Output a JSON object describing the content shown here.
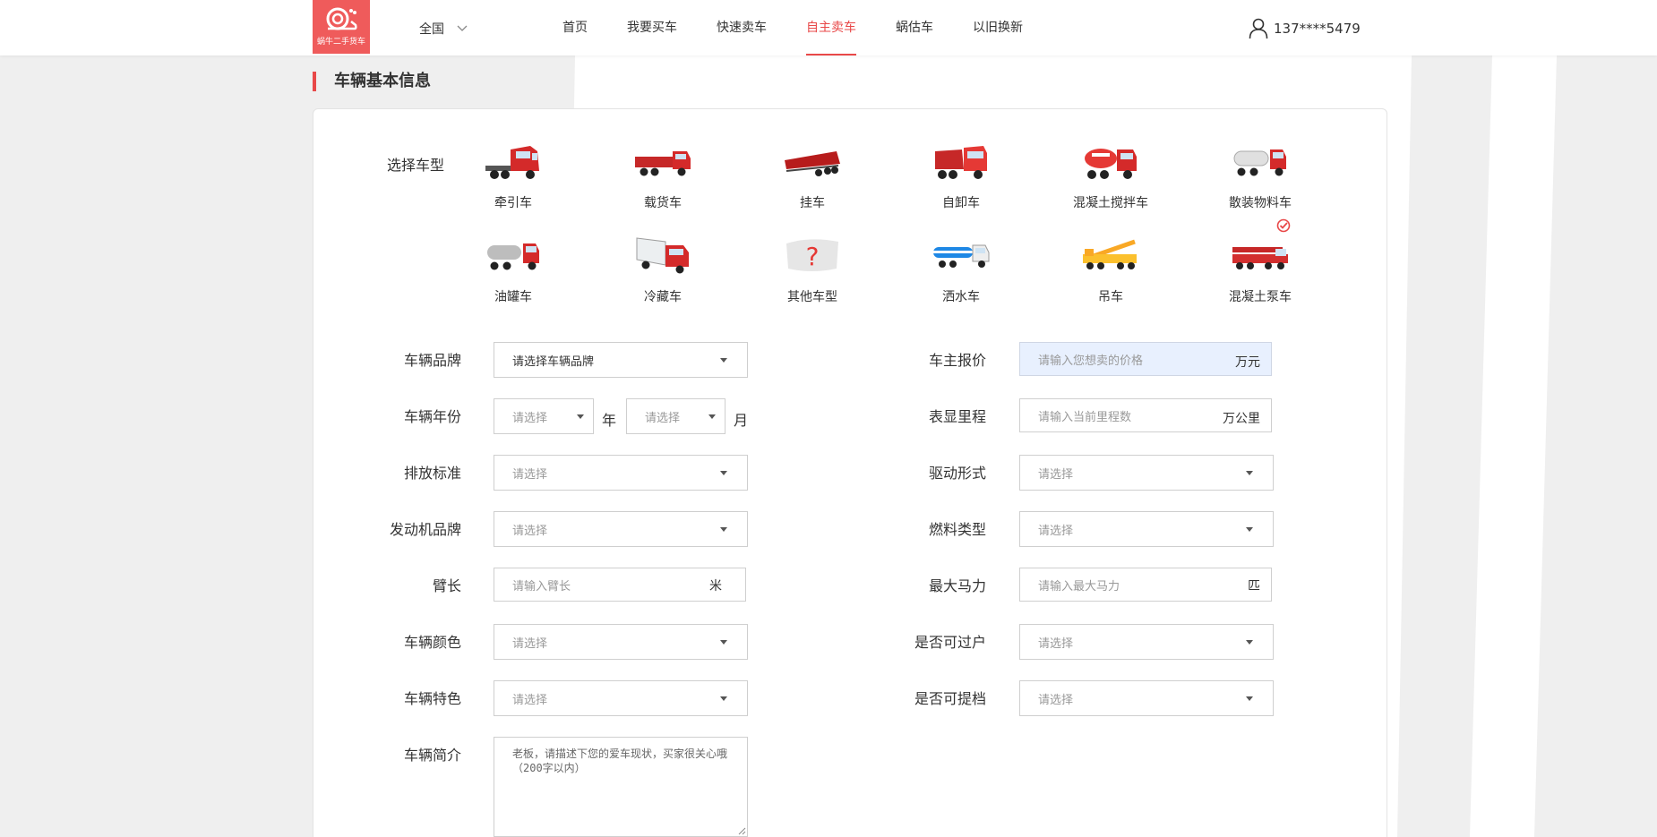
{
  "header": {
    "logo_text": "蜗牛二手货车",
    "region": "全国",
    "nav": [
      {
        "label": "首页",
        "active": false
      },
      {
        "label": "我要买车",
        "active": false
      },
      {
        "label": "快速卖车",
        "active": false
      },
      {
        "label": "自主卖车",
        "active": true
      },
      {
        "label": "蜗估车",
        "active": false
      },
      {
        "label": "以旧换新",
        "active": false
      }
    ],
    "user_phone": "137****5479"
  },
  "section_title": "车辆基本信息",
  "vehicle_types": {
    "label": "选择车型",
    "items": [
      {
        "name": "牵引车",
        "icon": "tractor-truck-icon"
      },
      {
        "name": "载货车",
        "icon": "cargo-truck-icon"
      },
      {
        "name": "挂车",
        "icon": "trailer-icon"
      },
      {
        "name": "自卸车",
        "icon": "dump-truck-icon"
      },
      {
        "name": "混凝土搅拌车",
        "icon": "concrete-mixer-icon"
      },
      {
        "name": "散装物料车",
        "icon": "bulk-material-truck-icon",
        "selected": true
      },
      {
        "name": "油罐车",
        "icon": "oil-tanker-icon"
      },
      {
        "name": "冷藏车",
        "icon": "refrigerated-truck-icon"
      },
      {
        "name": "其他车型",
        "icon": "question-mark-icon"
      },
      {
        "name": "洒水车",
        "icon": "sprinkler-truck-icon"
      },
      {
        "name": "吊车",
        "icon": "crane-truck-icon"
      },
      {
        "name": "混凝土泵车",
        "icon": "concrete-pump-truck-icon"
      }
    ]
  },
  "form": {
    "brand": {
      "label": "车辆品牌",
      "value": "请选择车辆品牌"
    },
    "price": {
      "label": "车主报价",
      "placeholder": "请输入您想卖的价格",
      "unit": "万元"
    },
    "year": {
      "label": "车辆年份",
      "year_placeholder": "请选择",
      "year_unit": "年",
      "month_placeholder": "请选择",
      "month_unit": "月"
    },
    "mileage": {
      "label": "表显里程",
      "placeholder": "请输入当前里程数",
      "unit": "万公里"
    },
    "emission": {
      "label": "排放标准",
      "placeholder": "请选择"
    },
    "drive": {
      "label": "驱动形式",
      "placeholder": "请选择"
    },
    "engine": {
      "label": "发动机品牌",
      "placeholder": "请选择"
    },
    "fuel": {
      "label": "燃料类型",
      "placeholder": "请选择"
    },
    "arm": {
      "label": "臂长",
      "placeholder": "请输入臂长",
      "unit": "米"
    },
    "horsepower": {
      "label": "最大马力",
      "placeholder": "请输入最大马力",
      "unit": "匹"
    },
    "color": {
      "label": "车辆颜色",
      "placeholder": "请选择"
    },
    "transfer": {
      "label": "是否可过户",
      "placeholder": "请选择"
    },
    "feature": {
      "label": "车辆特色",
      "placeholder": "请选择"
    },
    "file": {
      "label": "是否可提档",
      "placeholder": "请选择"
    },
    "intro": {
      "label": "车辆简介",
      "placeholder": "老板，请描述下您的爱车现状，买家很关心哦（200字以内）"
    }
  },
  "colors": {
    "accent": "#e84848",
    "logo_bg": "#ef5b5b",
    "price_bg": "#e8f0fe"
  }
}
